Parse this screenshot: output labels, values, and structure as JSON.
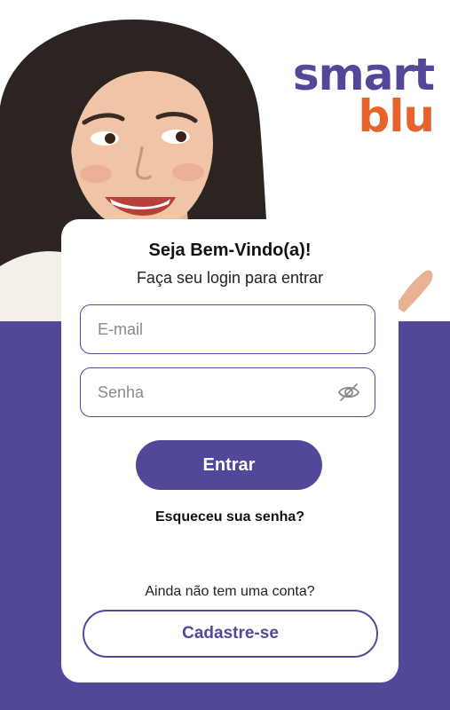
{
  "brand": {
    "logo_line1": "smart",
    "logo_line2": "blu",
    "color_primary": "#51489a",
    "color_accent": "#e8622b"
  },
  "login": {
    "title": "Seja Bem-Vindo(a)!",
    "subtitle": "Faça seu login para entrar",
    "email_placeholder": "E-mail",
    "email_value": "",
    "password_placeholder": "Senha",
    "password_value": "",
    "password_toggle_icon": "eye-slash-icon",
    "submit_label": "Entrar",
    "forgot_label": "Esqueceu sua senha?",
    "no_account_text": "Ainda não tem uma conta?",
    "signup_label": "Cadastre-se"
  }
}
